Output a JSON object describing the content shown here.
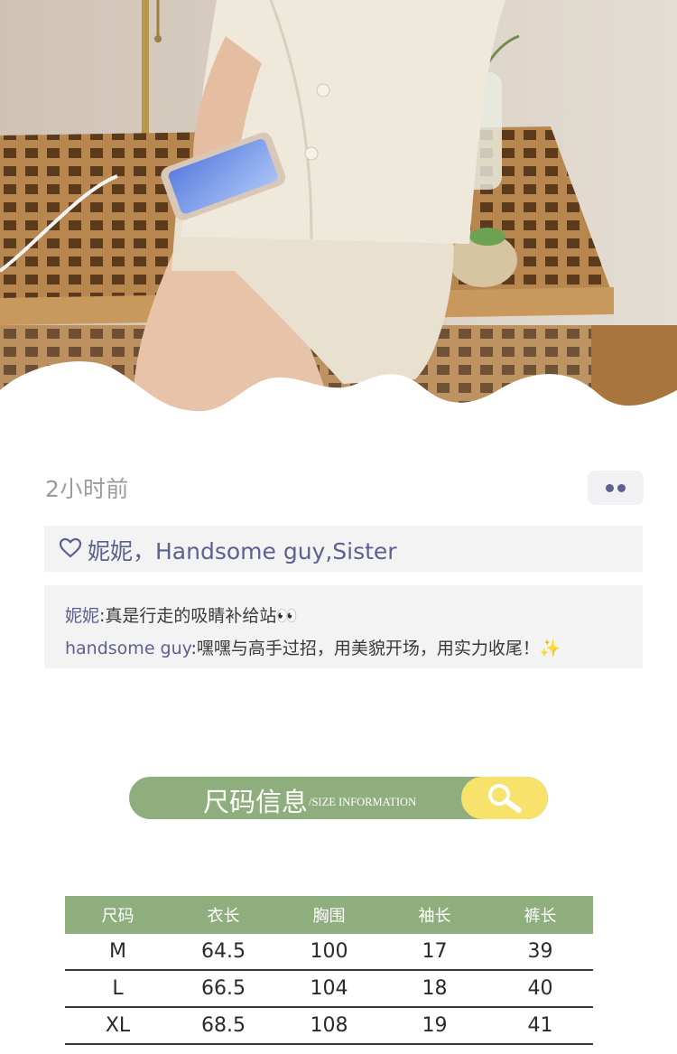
{
  "post": {
    "time": "2小时前",
    "likes": "妮妮，Handsome guy,Sister",
    "comments": [
      {
        "author": "妮妮",
        "separator": ":",
        "text": "真是行走的吸睛补给站👀"
      },
      {
        "author": "handsome guy",
        "separator": ":",
        "text": "嘿嘿与高手过招，用美貌开场，用实力收尾！✨"
      }
    ]
  },
  "size_banner": {
    "title_cn": "尺码信息",
    "title_en": "/SIZE INFORMATION",
    "icon": "search-icon"
  },
  "size_table": {
    "headers": [
      "尺码",
      "衣长",
      "胸围",
      "袖长",
      "裤长"
    ],
    "rows": [
      [
        "M",
        "64.5",
        "100",
        "17",
        "39"
      ],
      [
        "L",
        "66.5",
        "104",
        "18",
        "40"
      ],
      [
        "XL",
        "68.5",
        "108",
        "19",
        "41"
      ]
    ]
  },
  "colors": {
    "accent_green": "#8fae7e",
    "accent_yellow": "#f7e26b",
    "name_purple": "#5c6190"
  }
}
